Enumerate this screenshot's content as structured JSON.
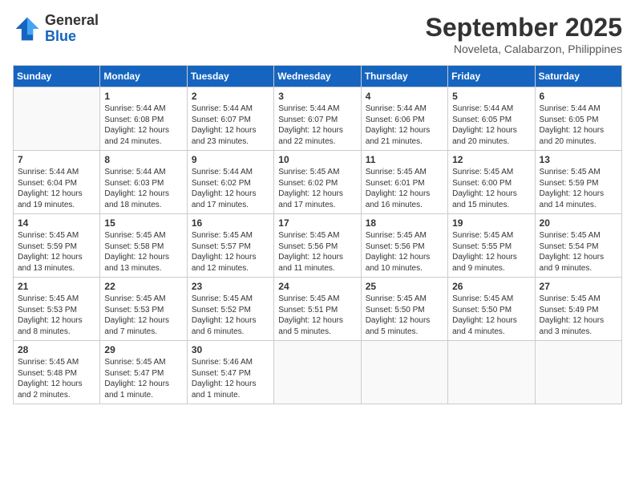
{
  "header": {
    "logo": {
      "general": "General",
      "blue": "Blue"
    },
    "month": "September 2025",
    "location": "Noveleta, Calabarzon, Philippines"
  },
  "weekdays": [
    "Sunday",
    "Monday",
    "Tuesday",
    "Wednesday",
    "Thursday",
    "Friday",
    "Saturday"
  ],
  "weeks": [
    [
      {
        "day": "",
        "info": ""
      },
      {
        "day": "1",
        "info": "Sunrise: 5:44 AM\nSunset: 6:08 PM\nDaylight: 12 hours\nand 24 minutes."
      },
      {
        "day": "2",
        "info": "Sunrise: 5:44 AM\nSunset: 6:07 PM\nDaylight: 12 hours\nand 23 minutes."
      },
      {
        "day": "3",
        "info": "Sunrise: 5:44 AM\nSunset: 6:07 PM\nDaylight: 12 hours\nand 22 minutes."
      },
      {
        "day": "4",
        "info": "Sunrise: 5:44 AM\nSunset: 6:06 PM\nDaylight: 12 hours\nand 21 minutes."
      },
      {
        "day": "5",
        "info": "Sunrise: 5:44 AM\nSunset: 6:05 PM\nDaylight: 12 hours\nand 20 minutes."
      },
      {
        "day": "6",
        "info": "Sunrise: 5:44 AM\nSunset: 6:05 PM\nDaylight: 12 hours\nand 20 minutes."
      }
    ],
    [
      {
        "day": "7",
        "info": "Sunrise: 5:44 AM\nSunset: 6:04 PM\nDaylight: 12 hours\nand 19 minutes."
      },
      {
        "day": "8",
        "info": "Sunrise: 5:44 AM\nSunset: 6:03 PM\nDaylight: 12 hours\nand 18 minutes."
      },
      {
        "day": "9",
        "info": "Sunrise: 5:44 AM\nSunset: 6:02 PM\nDaylight: 12 hours\nand 17 minutes."
      },
      {
        "day": "10",
        "info": "Sunrise: 5:45 AM\nSunset: 6:02 PM\nDaylight: 12 hours\nand 17 minutes."
      },
      {
        "day": "11",
        "info": "Sunrise: 5:45 AM\nSunset: 6:01 PM\nDaylight: 12 hours\nand 16 minutes."
      },
      {
        "day": "12",
        "info": "Sunrise: 5:45 AM\nSunset: 6:00 PM\nDaylight: 12 hours\nand 15 minutes."
      },
      {
        "day": "13",
        "info": "Sunrise: 5:45 AM\nSunset: 5:59 PM\nDaylight: 12 hours\nand 14 minutes."
      }
    ],
    [
      {
        "day": "14",
        "info": "Sunrise: 5:45 AM\nSunset: 5:59 PM\nDaylight: 12 hours\nand 13 minutes."
      },
      {
        "day": "15",
        "info": "Sunrise: 5:45 AM\nSunset: 5:58 PM\nDaylight: 12 hours\nand 13 minutes."
      },
      {
        "day": "16",
        "info": "Sunrise: 5:45 AM\nSunset: 5:57 PM\nDaylight: 12 hours\nand 12 minutes."
      },
      {
        "day": "17",
        "info": "Sunrise: 5:45 AM\nSunset: 5:56 PM\nDaylight: 12 hours\nand 11 minutes."
      },
      {
        "day": "18",
        "info": "Sunrise: 5:45 AM\nSunset: 5:56 PM\nDaylight: 12 hours\nand 10 minutes."
      },
      {
        "day": "19",
        "info": "Sunrise: 5:45 AM\nSunset: 5:55 PM\nDaylight: 12 hours\nand 9 minutes."
      },
      {
        "day": "20",
        "info": "Sunrise: 5:45 AM\nSunset: 5:54 PM\nDaylight: 12 hours\nand 9 minutes."
      }
    ],
    [
      {
        "day": "21",
        "info": "Sunrise: 5:45 AM\nSunset: 5:53 PM\nDaylight: 12 hours\nand 8 minutes."
      },
      {
        "day": "22",
        "info": "Sunrise: 5:45 AM\nSunset: 5:53 PM\nDaylight: 12 hours\nand 7 minutes."
      },
      {
        "day": "23",
        "info": "Sunrise: 5:45 AM\nSunset: 5:52 PM\nDaylight: 12 hours\nand 6 minutes."
      },
      {
        "day": "24",
        "info": "Sunrise: 5:45 AM\nSunset: 5:51 PM\nDaylight: 12 hours\nand 5 minutes."
      },
      {
        "day": "25",
        "info": "Sunrise: 5:45 AM\nSunset: 5:50 PM\nDaylight: 12 hours\nand 5 minutes."
      },
      {
        "day": "26",
        "info": "Sunrise: 5:45 AM\nSunset: 5:50 PM\nDaylight: 12 hours\nand 4 minutes."
      },
      {
        "day": "27",
        "info": "Sunrise: 5:45 AM\nSunset: 5:49 PM\nDaylight: 12 hours\nand 3 minutes."
      }
    ],
    [
      {
        "day": "28",
        "info": "Sunrise: 5:45 AM\nSunset: 5:48 PM\nDaylight: 12 hours\nand 2 minutes."
      },
      {
        "day": "29",
        "info": "Sunrise: 5:45 AM\nSunset: 5:47 PM\nDaylight: 12 hours\nand 1 minute."
      },
      {
        "day": "30",
        "info": "Sunrise: 5:46 AM\nSunset: 5:47 PM\nDaylight: 12 hours\nand 1 minute."
      },
      {
        "day": "",
        "info": ""
      },
      {
        "day": "",
        "info": ""
      },
      {
        "day": "",
        "info": ""
      },
      {
        "day": "",
        "info": ""
      }
    ]
  ]
}
